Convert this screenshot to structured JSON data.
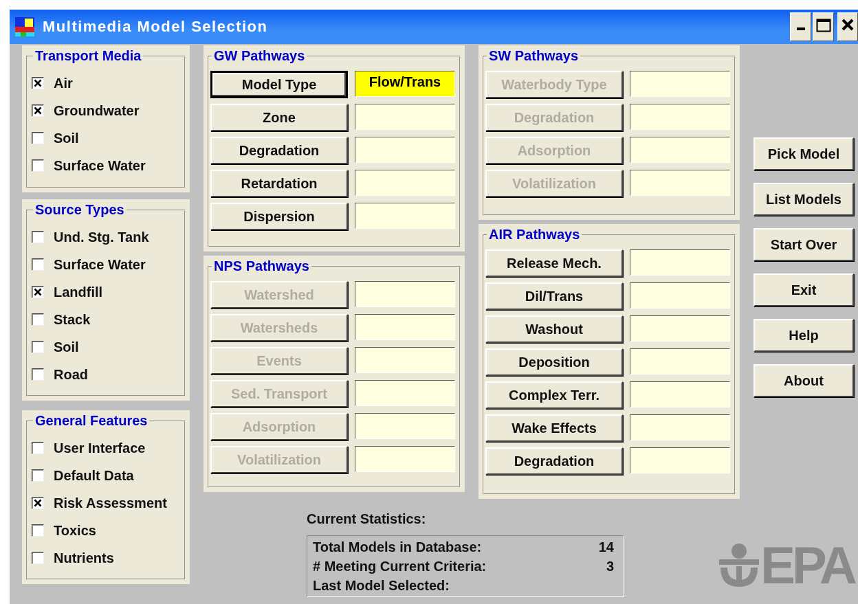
{
  "window": {
    "title": "Multimedia Model Selection"
  },
  "transport_media": {
    "title": "Transport Media",
    "items": [
      {
        "label": "Air",
        "checked": true
      },
      {
        "label": "Groundwater",
        "checked": true
      },
      {
        "label": "Soil",
        "checked": false
      },
      {
        "label": "Surface Water",
        "checked": false
      }
    ]
  },
  "source_types": {
    "title": "Source Types",
    "items": [
      {
        "label": "Und. Stg. Tank",
        "checked": false
      },
      {
        "label": "Surface Water",
        "checked": false
      },
      {
        "label": "Landfill",
        "checked": true
      },
      {
        "label": "Stack",
        "checked": false
      },
      {
        "label": "Soil",
        "checked": false
      },
      {
        "label": "Road",
        "checked": false
      }
    ]
  },
  "general_features": {
    "title": "General Features",
    "items": [
      {
        "label": "User Interface",
        "checked": false
      },
      {
        "label": "Default Data",
        "checked": false
      },
      {
        "label": "Risk Assessment",
        "checked": true
      },
      {
        "label": "Toxics",
        "checked": false
      },
      {
        "label": "Nutrients",
        "checked": false
      }
    ]
  },
  "gw_pathways": {
    "title": "GW Pathways",
    "rows": [
      {
        "button": "Model Type",
        "disabled": false,
        "focused": true,
        "highlighted": true,
        "value": "Flow/Trans"
      },
      {
        "button": "Zone",
        "disabled": false,
        "focused": false,
        "highlighted": false
      },
      {
        "button": "Degradation",
        "disabled": false,
        "focused": false,
        "highlighted": false
      },
      {
        "button": "Retardation",
        "disabled": false,
        "focused": false,
        "highlighted": false
      },
      {
        "button": "Dispersion",
        "disabled": false,
        "focused": false,
        "highlighted": false
      }
    ]
  },
  "nps_pathways": {
    "title": "NPS Pathways",
    "rows": [
      {
        "button": "Watershed",
        "disabled": true,
        "focused": false,
        "highlighted": false
      },
      {
        "button": "Watersheds",
        "disabled": true,
        "focused": false,
        "highlighted": false
      },
      {
        "button": "Events",
        "disabled": true,
        "focused": false,
        "highlighted": false
      },
      {
        "button": "Sed. Transport",
        "disabled": true,
        "focused": false,
        "highlighted": false
      },
      {
        "button": "Adsorption",
        "disabled": true,
        "focused": false,
        "highlighted": false
      },
      {
        "button": "Volatilization",
        "disabled": true,
        "focused": false,
        "highlighted": false
      }
    ]
  },
  "sw_pathways": {
    "title": "SW Pathways",
    "rows": [
      {
        "button": "Waterbody Type",
        "disabled": true,
        "focused": false,
        "highlighted": false
      },
      {
        "button": "Degradation",
        "disabled": true,
        "focused": false,
        "highlighted": false
      },
      {
        "button": "Adsorption",
        "disabled": true,
        "focused": false,
        "highlighted": false
      },
      {
        "button": "Volatilization",
        "disabled": true,
        "focused": false,
        "highlighted": false
      }
    ]
  },
  "air_pathways": {
    "title": "AIR Pathways",
    "rows": [
      {
        "button": "Release Mech.",
        "disabled": false,
        "focused": false,
        "highlighted": false
      },
      {
        "button": "Dil/Trans",
        "disabled": false,
        "focused": false,
        "highlighted": false
      },
      {
        "button": "Washout",
        "disabled": false,
        "focused": false,
        "highlighted": false
      },
      {
        "button": "Deposition",
        "disabled": false,
        "focused": false,
        "highlighted": false
      },
      {
        "button": "Complex Terr.",
        "disabled": false,
        "focused": false,
        "highlighted": false
      },
      {
        "button": "Wake Effects",
        "disabled": false,
        "focused": false,
        "highlighted": false
      },
      {
        "button": "Degradation",
        "disabled": false,
        "focused": false,
        "highlighted": false
      }
    ]
  },
  "actions": [
    "Pick Model",
    "List Models",
    "Start Over",
    "Exit",
    "Help",
    "About"
  ],
  "statistics": {
    "title": "Current Statistics:",
    "rows": [
      {
        "label": "Total Models in Database:",
        "value": "14"
      },
      {
        "label": "# Meeting Current Criteria:",
        "value": "3"
      },
      {
        "label": "Last Model Selected:"
      }
    ]
  },
  "logo": {
    "text": "EPA"
  }
}
